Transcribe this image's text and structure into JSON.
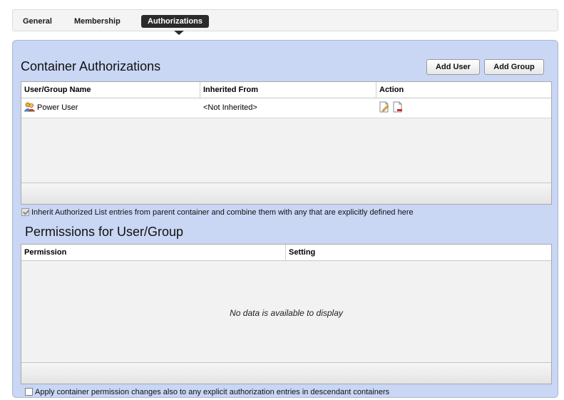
{
  "tabs": [
    {
      "label": "General",
      "active": false
    },
    {
      "label": "Membership",
      "active": false
    },
    {
      "label": "Authorizations",
      "active": true
    }
  ],
  "container_auth": {
    "title": "Container Authorizations",
    "add_user_label": "Add User",
    "add_group_label": "Add Group",
    "columns": [
      "User/Group Name",
      "Inherited From",
      "Action"
    ],
    "rows": [
      {
        "name": "Power User",
        "inherited_from": "<Not Inherited>",
        "user_icon": "user-group-icon",
        "actions": [
          "edit-icon",
          "delete-icon"
        ]
      }
    ]
  },
  "inherit_checkbox": {
    "label": "Inherit Authorized List entries from parent container and combine them with any that are explicitly defined here",
    "checked": true
  },
  "permissions": {
    "title": "Permissions for User/Group",
    "columns": [
      "Permission",
      "Setting"
    ],
    "empty_text": "No data is available to display"
  },
  "apply_checkbox": {
    "label": "Apply container permission changes also to any explicit authorization entries in descendant containers",
    "checked": false
  },
  "colors": {
    "panel_bg": "#c9d6f4",
    "active_tab_bg": "#2b2b2b"
  }
}
